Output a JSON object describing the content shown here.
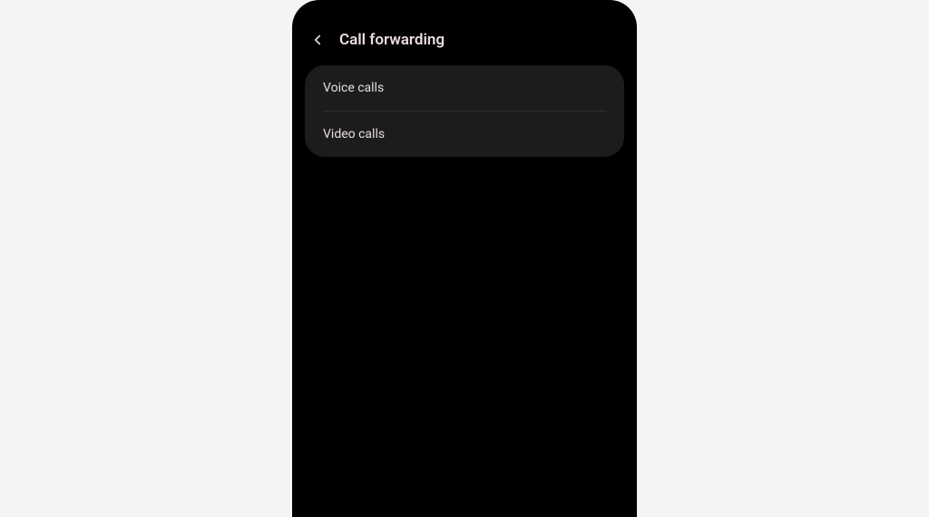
{
  "header": {
    "title": "Call forwarding"
  },
  "options": [
    {
      "label": "Voice calls"
    },
    {
      "label": "Video calls"
    }
  ]
}
